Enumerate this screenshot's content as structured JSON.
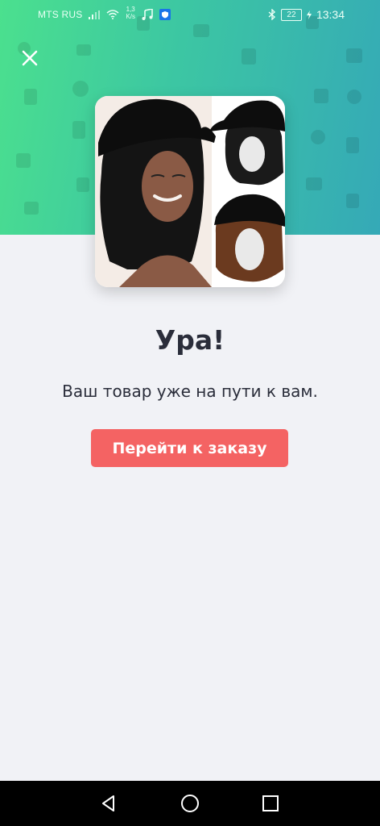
{
  "status_bar": {
    "carrier": "MTS RUS",
    "speed_value": "1,3",
    "speed_unit": "K/s",
    "battery": "22",
    "time": "13:34"
  },
  "success": {
    "title": "Ура!",
    "message": "Ваш товар уже на пути к вам.",
    "button_label": "Перейти к заказу"
  },
  "colors": {
    "gradient_start": "#4be08e",
    "gradient_end": "#35a9b7",
    "page_background": "#f1f2f6",
    "button": "#f46363",
    "text": "#2a2d3a"
  },
  "icons": {
    "close": "close-icon",
    "back": "back-icon",
    "home": "home-icon",
    "recents": "recents-icon"
  }
}
